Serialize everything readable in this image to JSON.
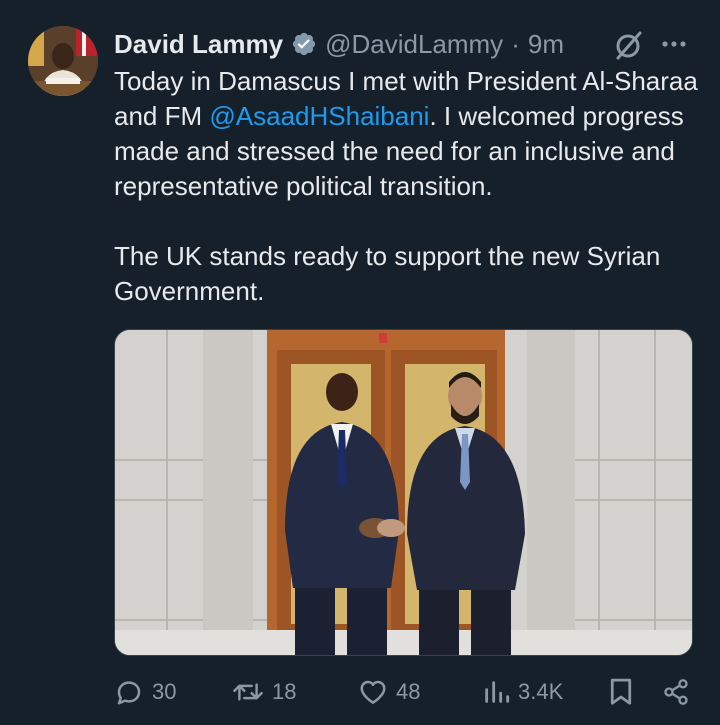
{
  "author": {
    "display_name": "David Lammy",
    "handle": "@DavidLammy",
    "separator": "·",
    "time": "9m",
    "verified_icon": "verified-badge-icon",
    "avatar_icon": "profile-avatar"
  },
  "tweet": {
    "text_part1": "Today in Damascus I met with President Al-Sharaa and FM ",
    "mention": "@AsaadHShaibani",
    "text_part2": ". I welcomed progress made and stressed the need for an inclusive and representative political transition.",
    "text_paragraph2": "The UK stands ready to support the new Syrian Government.",
    "media_icon": "tweet-photo"
  },
  "actions": {
    "reply_count": "30",
    "retweet_count": "18",
    "like_count": "48",
    "views_count": "3.4K",
    "icons": [
      "reply-icon",
      "retweet-icon",
      "like-icon",
      "views-icon",
      "bookmark-icon",
      "share-icon"
    ]
  },
  "colors": {
    "background": "#15202b",
    "text": "#e7e9ea",
    "muted": "#8b98a5",
    "accent": "#1d9bf0"
  }
}
